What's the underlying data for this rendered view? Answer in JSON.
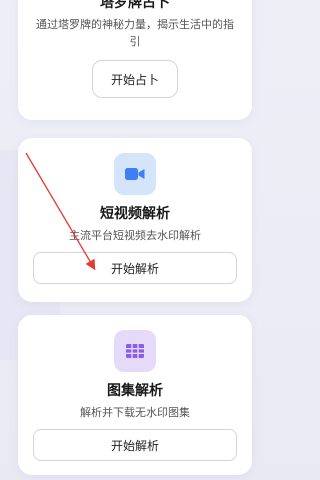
{
  "cards": [
    {
      "title": "塔罗牌占卜",
      "desc": "通过塔罗牌的神秘力量，揭示生活中的指引",
      "button": "开始占卜"
    },
    {
      "icon": "video-camera-icon",
      "title": "短视频解析",
      "desc": "主流平台短视频去水印解析",
      "button": "开始解析"
    },
    {
      "icon": "image-grid-icon",
      "title": "图集解析",
      "desc": "解析并下载无水印图集",
      "button": "开始解析"
    }
  ],
  "colors": {
    "video_icon": "#3f7ff5",
    "grid_icon": "#8a5cf0",
    "arrow": "#e53935"
  }
}
